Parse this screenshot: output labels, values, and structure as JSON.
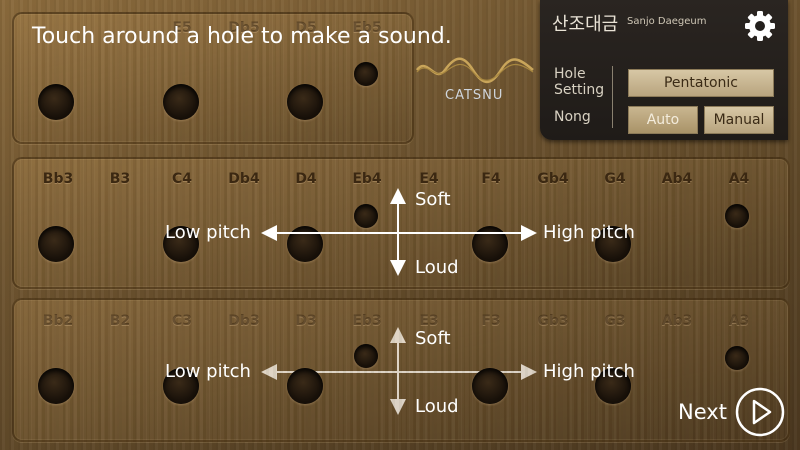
{
  "instruction": "Touch around a hole to make a sound.",
  "brand": {
    "logo_text": "CATSNU"
  },
  "settings": {
    "title_korean": "산조대금",
    "title_roman": "Sanjo Daegeum",
    "hole_setting_label_line1": "Hole",
    "hole_setting_label_line2": "Setting",
    "hole_setting_value": "Pentatonic",
    "nong_label": "Nong",
    "nong_auto": "Auto",
    "nong_manual": "Manual",
    "gear_icon": "gear-icon"
  },
  "top_panel": {
    "notes": [
      "E5",
      "Db5",
      "D5",
      "Eb5"
    ]
  },
  "middle_panel": {
    "notes": [
      "Bb3",
      "B3",
      "C4",
      "Db4",
      "D4",
      "Eb4",
      "E4",
      "F4",
      "Gb4",
      "G4",
      "Ab4",
      "A4"
    ],
    "soft": "Soft",
    "loud": "Loud",
    "low_pitch": "Low pitch",
    "high_pitch": "High pitch"
  },
  "bottom_panel": {
    "notes": [
      "Bb2",
      "B2",
      "C3",
      "Db3",
      "D3",
      "Eb3",
      "E3",
      "F3",
      "Gb3",
      "G3",
      "Ab3",
      "A3"
    ],
    "soft": "Soft",
    "loud": "Loud",
    "low_pitch": "Low pitch",
    "high_pitch": "High pitch"
  },
  "next_label": "Next"
}
